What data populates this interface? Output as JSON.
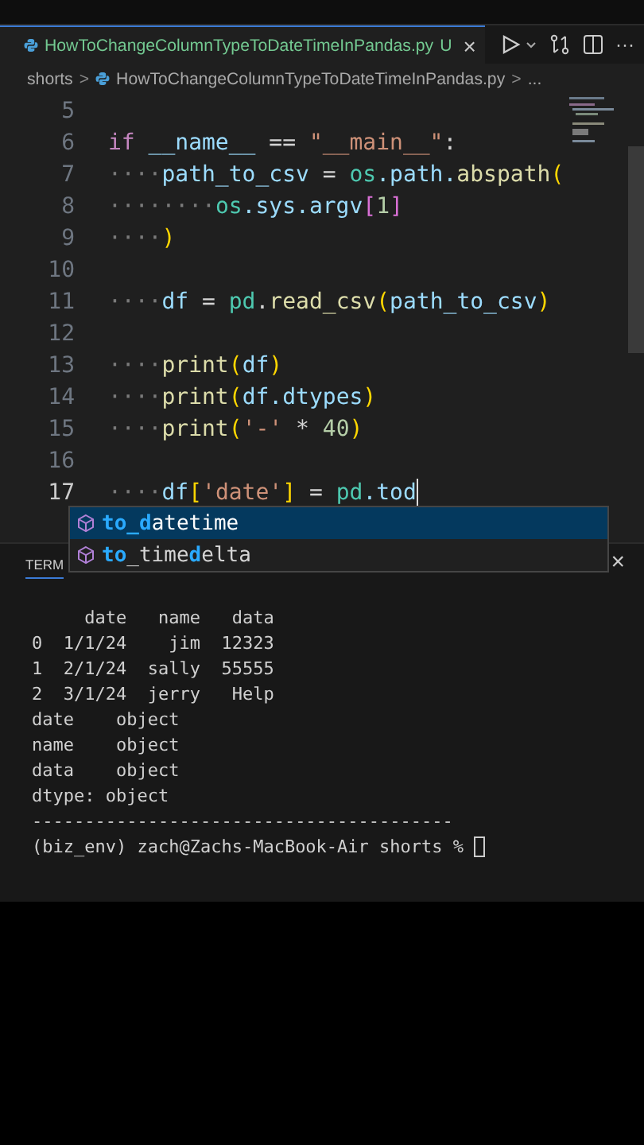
{
  "tab": {
    "title": "HowToChangeColumnTypeToDateTimeInPandas.py",
    "status": "U",
    "close": "×"
  },
  "toolbar": {
    "more": "···"
  },
  "breadcrumb": {
    "items": [
      "shorts",
      "HowToChangeColumnTypeToDateTimeInPandas.py",
      "..."
    ],
    "separator": ">"
  },
  "code_lines": [
    {
      "number": "5",
      "active": false
    },
    {
      "number": "6",
      "active": false,
      "tokens": [
        {
          "t": "if",
          "kind": "kw"
        },
        {
          "t": " __name__",
          "kind": "var"
        },
        {
          "t": " == ",
          "kind": "op"
        },
        {
          "t": "\"__main__\"",
          "kind": "str"
        },
        {
          "t": ":",
          "kind": "op"
        }
      ]
    },
    {
      "number": "7",
      "active": false,
      "tokens": [
        {
          "t": "····",
          "kind": "ws"
        },
        {
          "t": "path_to_csv",
          "kind": "var"
        },
        {
          "t": " = ",
          "kind": "op"
        },
        {
          "t": "os",
          "kind": "mod"
        },
        {
          "t": ".path.",
          "kind": "var"
        },
        {
          "t": "abspath",
          "kind": "fn"
        },
        {
          "t": "(",
          "kind": "br1"
        }
      ]
    },
    {
      "number": "8",
      "active": false,
      "tokens": [
        {
          "t": "········",
          "kind": "ws"
        },
        {
          "t": "os",
          "kind": "mod"
        },
        {
          "t": ".sys.argv",
          "kind": "var"
        },
        {
          "t": "[",
          "kind": "br2"
        },
        {
          "t": "1",
          "kind": "num"
        },
        {
          "t": "]",
          "kind": "br2"
        }
      ]
    },
    {
      "number": "9",
      "active": false,
      "tokens": [
        {
          "t": "····",
          "kind": "ws"
        },
        {
          "t": ")",
          "kind": "br1"
        }
      ]
    },
    {
      "number": "10",
      "active": false
    },
    {
      "number": "11",
      "active": false,
      "tokens": [
        {
          "t": "····",
          "kind": "ws"
        },
        {
          "t": "df",
          "kind": "var"
        },
        {
          "t": " = ",
          "kind": "op"
        },
        {
          "t": "pd",
          "kind": "mod"
        },
        {
          "t": ".",
          "kind": "op"
        },
        {
          "t": "read_csv",
          "kind": "fn"
        },
        {
          "t": "(",
          "kind": "br1"
        },
        {
          "t": "path_to_csv",
          "kind": "var"
        },
        {
          "t": ")",
          "kind": "br1"
        }
      ]
    },
    {
      "number": "12",
      "active": false
    },
    {
      "number": "13",
      "active": false,
      "tokens": [
        {
          "t": "····",
          "kind": "ws"
        },
        {
          "t": "print",
          "kind": "fn"
        },
        {
          "t": "(",
          "kind": "br1"
        },
        {
          "t": "df",
          "kind": "var"
        },
        {
          "t": ")",
          "kind": "br1"
        }
      ]
    },
    {
      "number": "14",
      "active": false,
      "tokens": [
        {
          "t": "····",
          "kind": "ws"
        },
        {
          "t": "print",
          "kind": "fn"
        },
        {
          "t": "(",
          "kind": "br1"
        },
        {
          "t": "df.dtypes",
          "kind": "var"
        },
        {
          "t": ")",
          "kind": "br1"
        }
      ]
    },
    {
      "number": "15",
      "active": false,
      "tokens": [
        {
          "t": "····",
          "kind": "ws"
        },
        {
          "t": "print",
          "kind": "fn"
        },
        {
          "t": "(",
          "kind": "br1"
        },
        {
          "t": "'-'",
          "kind": "str"
        },
        {
          "t": " * ",
          "kind": "op"
        },
        {
          "t": "40",
          "kind": "num"
        },
        {
          "t": ")",
          "kind": "br1"
        }
      ]
    },
    {
      "number": "16",
      "active": false
    },
    {
      "number": "17",
      "active": true,
      "tokens": [
        {
          "t": "····",
          "kind": "ws"
        },
        {
          "t": "df",
          "kind": "var"
        },
        {
          "t": "[",
          "kind": "br1"
        },
        {
          "t": "'date'",
          "kind": "str"
        },
        {
          "t": "]",
          "kind": "br1"
        },
        {
          "t": " = ",
          "kind": "op"
        },
        {
          "t": "pd",
          "kind": "mod"
        },
        {
          "t": ".tod",
          "kind": "var"
        }
      ]
    }
  ],
  "suggestions": [
    {
      "label": "**to_d**atetime",
      "selected": true
    },
    {
      "label": "**to**_time**d**elta",
      "selected": false
    }
  ],
  "panel": {
    "tab": "TERM",
    "close": "×"
  },
  "terminal_lines": [
    "     date   name   data",
    "0  1/1/24    jim  12323",
    "1  2/1/24  sally  55555",
    "2  3/1/24  jerry   Help",
    "date    object",
    "name    object",
    "data    object",
    "dtype: object",
    "----------------------------------------",
    "(biz_env) zach@Zachs-MacBook-Air shorts % "
  ]
}
